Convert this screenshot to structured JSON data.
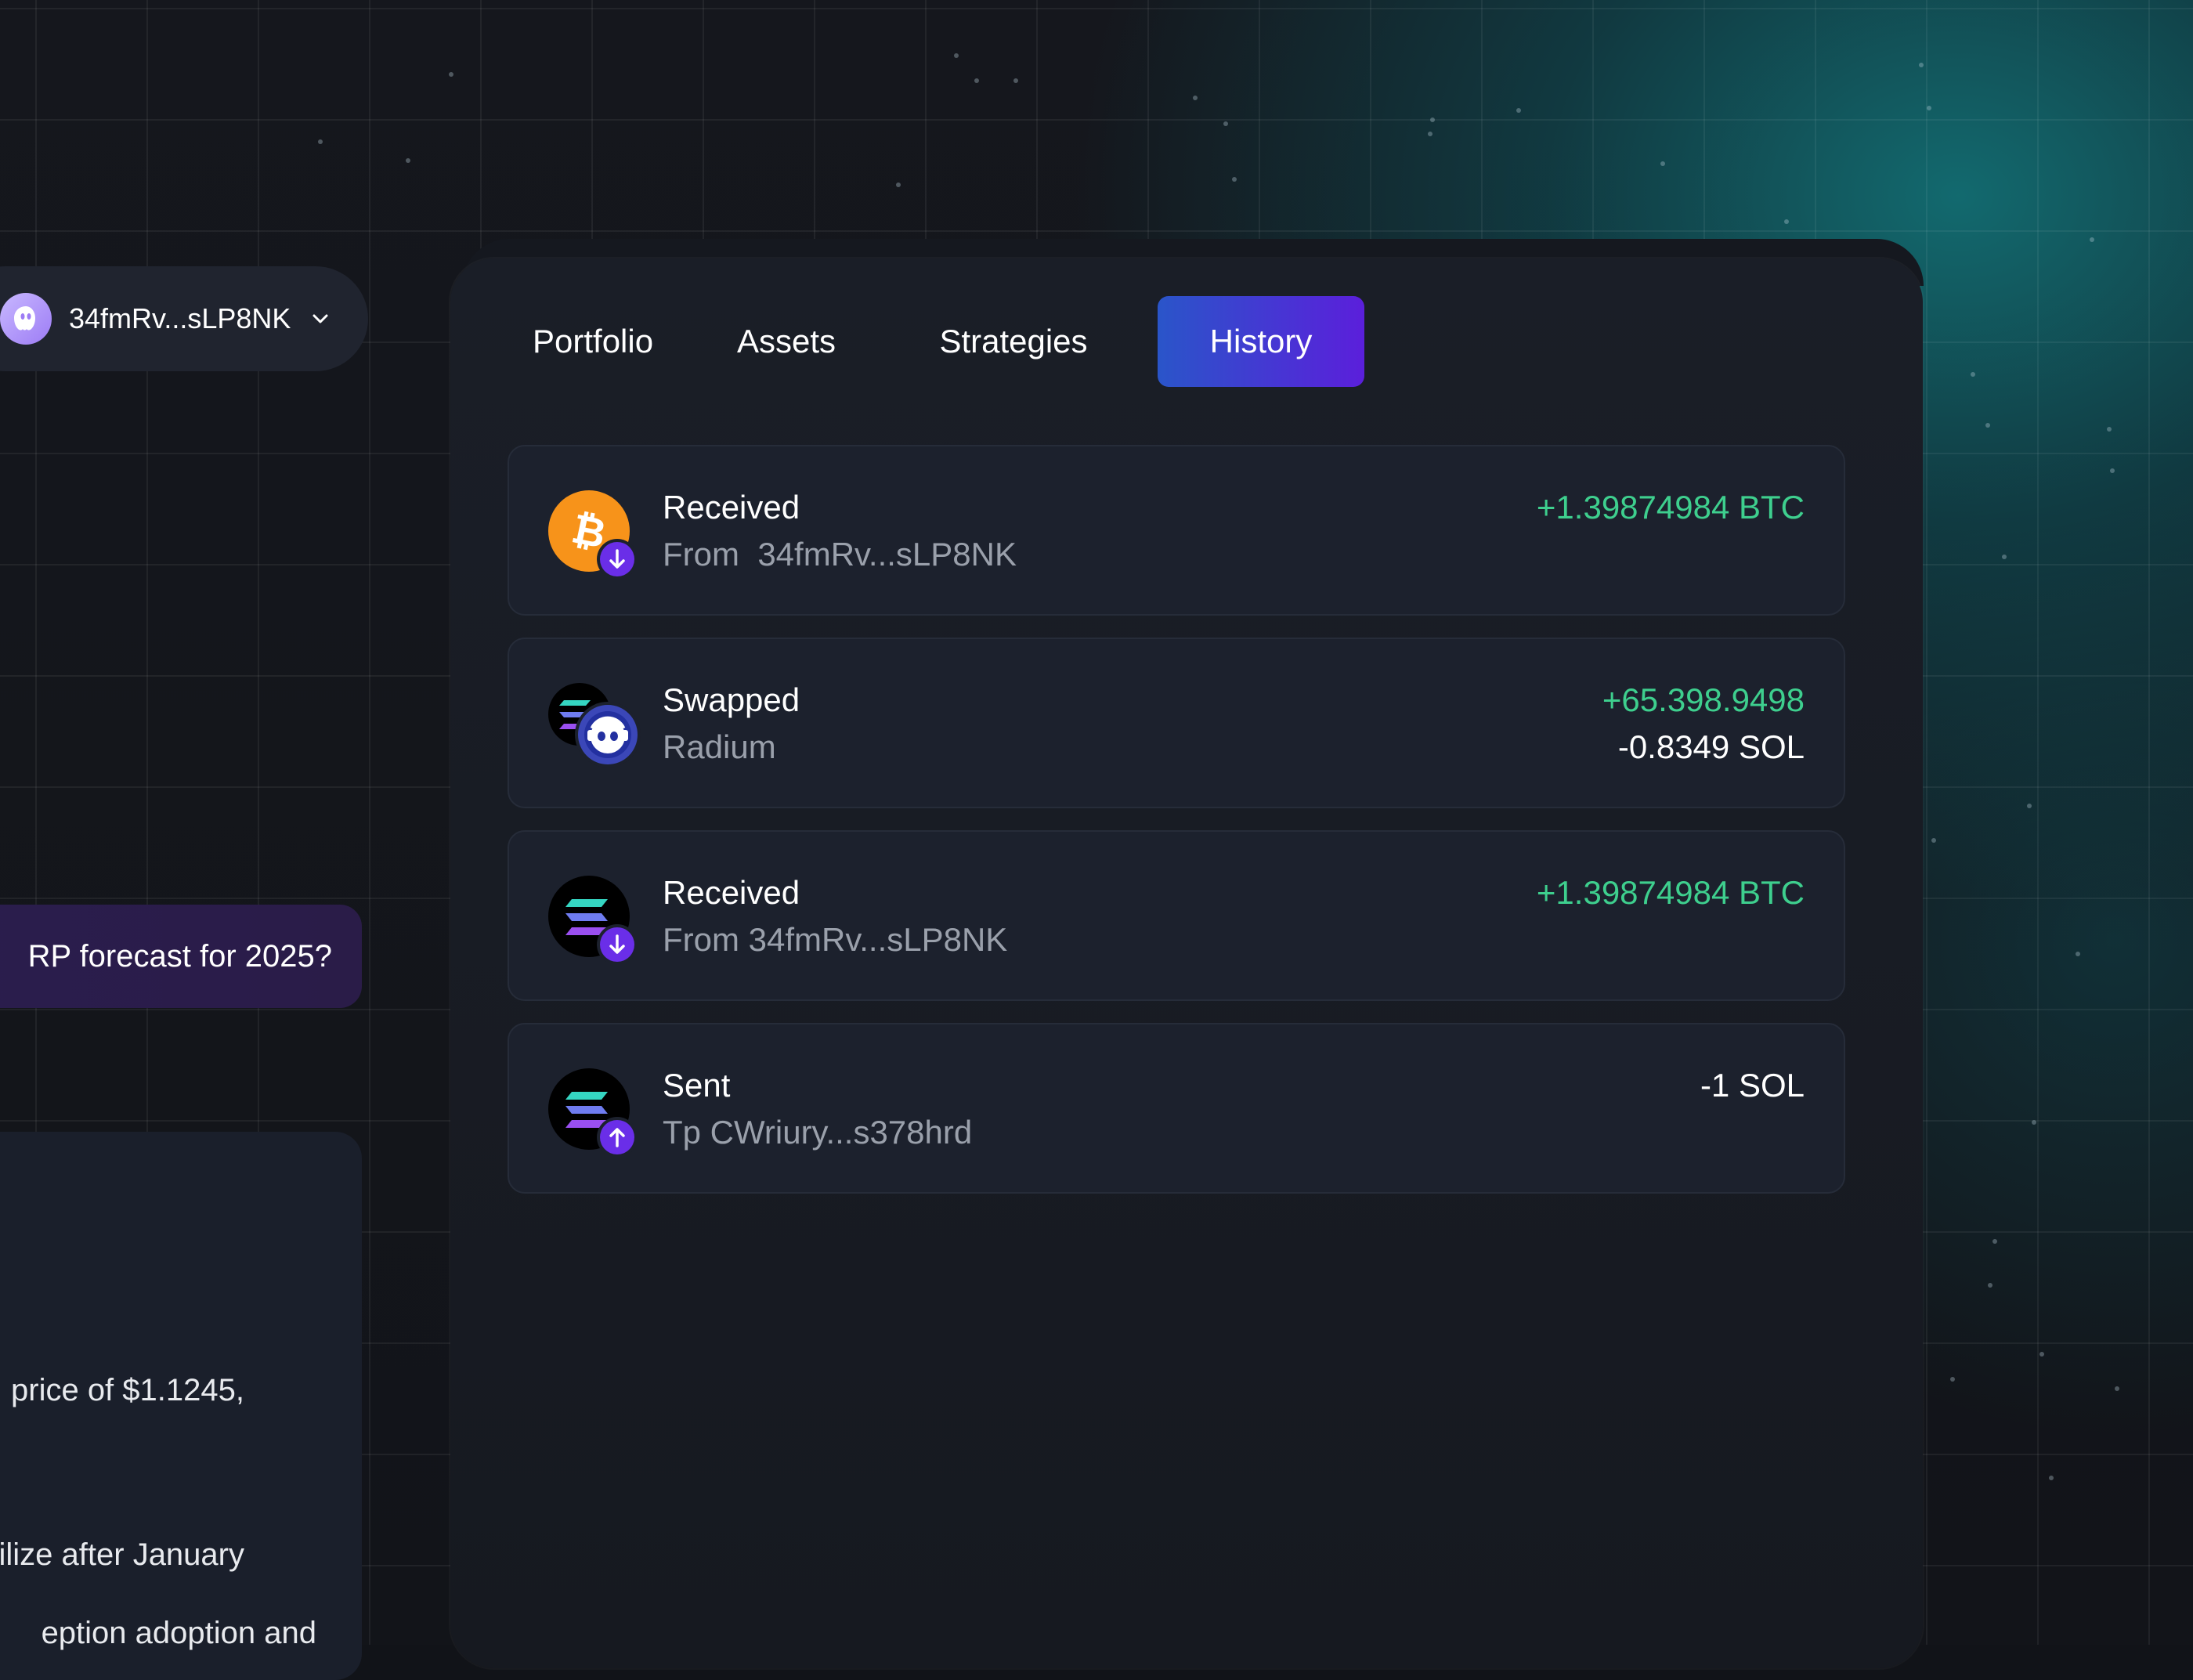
{
  "wallet": {
    "address": "34fmRv...sLP8NK"
  },
  "chat": {
    "question": "RP forecast for 2025?",
    "answer_lines": [
      "price of $1.1245,",
      "ilize after January",
      "eption adoption and"
    ]
  },
  "tabs": [
    {
      "label": "Portfolio",
      "active": false
    },
    {
      "label": "Assets",
      "active": false
    },
    {
      "label": "Strategies",
      "active": false
    },
    {
      "label": "History",
      "active": true
    }
  ],
  "transactions": [
    {
      "icon": "bitcoin-received-icon",
      "title": "Received",
      "subtitle": "From  34fmRv...sLP8NK",
      "amount": "+1.39874984 BTC",
      "amount2": ""
    },
    {
      "icon": "solana-swap-icon",
      "title": "Swapped",
      "subtitle": "Radium",
      "amount": "+65.398.9498",
      "amount2": "-0.8349 SOL"
    },
    {
      "icon": "solana-received-icon",
      "title": "Received",
      "subtitle": "From 34fmRv...sLP8NK",
      "amount": "+1.39874984 BTC",
      "amount2": ""
    },
    {
      "icon": "solana-sent-icon",
      "title": "Sent",
      "subtitle": "Tp CWriury...s378hrd",
      "amount": "-1 SOL",
      "amount2": ""
    }
  ],
  "colors": {
    "positive": "#3ecf8e",
    "accent_start": "#2a55c9",
    "accent_end": "#5b1fdb",
    "bitcoin": "#f7931a",
    "badge": "#6a2ee8"
  }
}
